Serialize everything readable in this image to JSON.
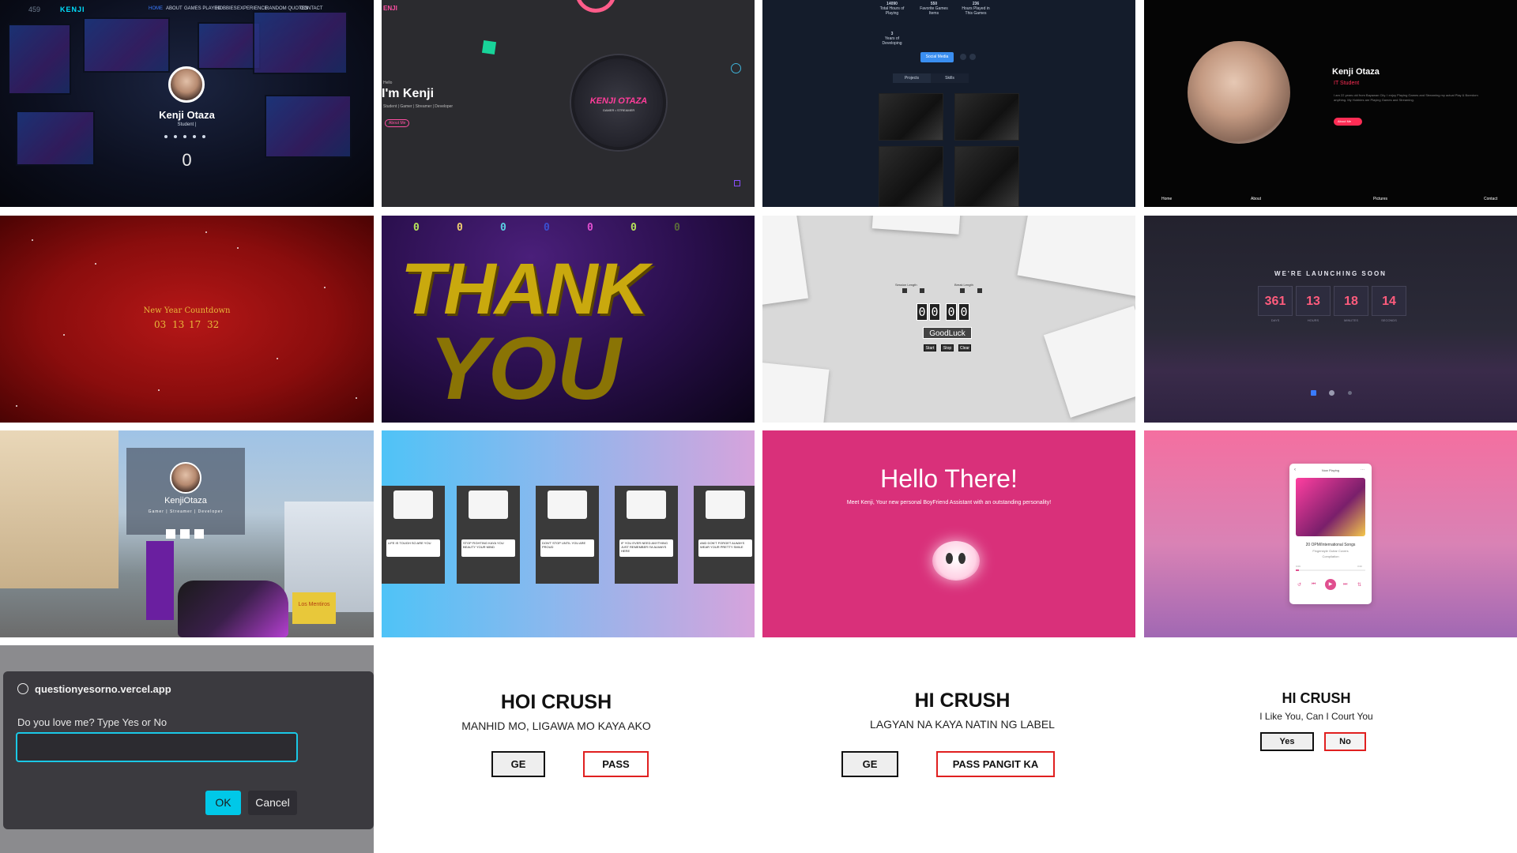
{
  "tiles": {
    "portfolio_home": {
      "brand": "KENJI",
      "counter_corner": "459",
      "nav": [
        "HOME",
        "ABOUT",
        "GAMES PLAYED",
        "HOBBIES",
        "EXPERIENCE",
        "RANDOM QUOTES",
        "CONTACT"
      ],
      "name": "Kenji Otaza",
      "role": "Student |",
      "counter": "0"
    },
    "portfolio_intro": {
      "brand": "ENJI",
      "greeting": "Hello",
      "headline": "I'm Kenji",
      "tagline": "Student | Gamer | Streamer | Developer",
      "button": "About Me",
      "logo_text": "KENJI OTAZA",
      "logo_sub": "GAMER • STREAMER"
    },
    "stats_page": {
      "stats": [
        {
          "value": "14090",
          "label": "Total Hours of Playing"
        },
        {
          "value": "550",
          "label": "Favorite Games Items"
        },
        {
          "value": "236",
          "label": "Hours Played in This Games"
        }
      ],
      "small_stat": "3",
      "small_label": "Years of Developing",
      "primary_button": "Social Media",
      "tabs": [
        "Projects",
        "Skills"
      ]
    },
    "about_page": {
      "name": "Kenji Otaza",
      "role": "IT Student",
      "bio": "I am 22 years old from Bayawan City. I enjoy Playing Games and Streaming my actual Play & Boredom anything. My Hobbies are Playing Games and Streaming.",
      "button": "About Me",
      "footer": [
        "Home",
        "About",
        "Pictures",
        "Contact"
      ]
    },
    "new_year": {
      "title": "New Year Countdown",
      "values": [
        "03",
        "13",
        "17",
        "32"
      ]
    },
    "thank_you": {
      "line1": "THANK",
      "line2": "YOU",
      "digits": [
        "0",
        "0",
        "0",
        "0",
        "0",
        "0",
        "0"
      ]
    },
    "pomodoro": {
      "session_label": "Session Length",
      "break_label": "Break Length",
      "digits": [
        "0",
        "0",
        "0",
        "0"
      ],
      "message": "GoodLuck",
      "buttons": [
        "Start",
        "Stop",
        "Clear"
      ]
    },
    "launching": {
      "title": "WE'RE LAUNCHING SOON",
      "values": [
        "361",
        "13",
        "18",
        "14"
      ],
      "labels": [
        "DAYS",
        "HOURS",
        "MINUTES",
        "SECONDS"
      ]
    },
    "gta_card": {
      "name": "KenjiOtaza",
      "role": "Gamer | Streamer | Developer",
      "sign": "Los Mentiros"
    },
    "stickers": {
      "notes": [
        "LIFE IS TOUGH SO ARE YOU",
        "STOP FIGHTING KAYA YOU BEAUTY YOUR MIND",
        "DON'T STOP UNTIL YOU ARE PROUD",
        "IF YOU EVER NEED ANYTHING JUST REMEMBER I'M ALWAYS HERE",
        "AND DON'T FORGET ALWAYS WEAR YOUR PRETTY SMILE"
      ]
    },
    "hello_there": {
      "title": "Hello There!",
      "subtitle": "Meet Kenji, Your new personal BoyFriend Assistant with an outstanding personality!"
    },
    "music_player": {
      "header": "Now Playing",
      "song": "20 OPM/International Songs",
      "artist": "Fingerstyle Guitar Covers",
      "album": "Compilation",
      "time_start": "0:09",
      "time_end": "3:20",
      "progress": 0.05
    },
    "prompt_dialog": {
      "site": "questionyesorno.vercel.app",
      "question": "Do you love me? Type Yes or No",
      "input_value": "",
      "ok": "OK",
      "cancel": "Cancel"
    },
    "hoi_crush": {
      "title": "HOI CRUSH",
      "subtitle": "MANHID MO, LIGAWA MO KAYA AKO",
      "btn_yes": "GE",
      "btn_no": "PASS"
    },
    "hi_crush_label": {
      "title": "HI CRUSH",
      "subtitle": "LAGYAN NA KAYA NATIN NG LABEL",
      "btn_yes": "GE",
      "btn_no": "PASS PANGIT KA"
    },
    "hi_crush_court": {
      "title": "HI CRUSH",
      "subtitle": "I Like You, Can I Court You",
      "btn_yes": "Yes",
      "btn_no": "No"
    }
  },
  "colors": {
    "accent_cyan": "#00bcd4",
    "accent_pink": "#ff5c7d",
    "accent_red": "#e02020",
    "gold": "#e8b93a"
  }
}
